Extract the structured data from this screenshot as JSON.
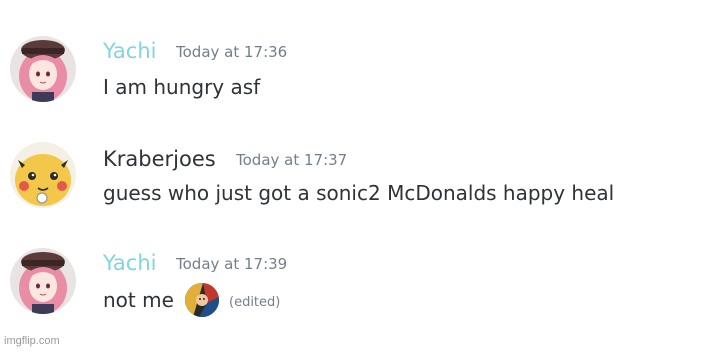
{
  "colors": {
    "yachi_name": "#7ed6df",
    "kraberjoes_name": "#2e3338",
    "timestamp": "#747f8d",
    "message_text": "#2e3338"
  },
  "messages": [
    {
      "author": "Yachi",
      "timestamp": "Today at 17:36",
      "text": "I am hungry asf",
      "avatar_icon": "anime-girl-avatar"
    },
    {
      "author": "Kraberjoes",
      "timestamp": "Today at 17:37",
      "text": "guess who just got a sonic2 McDonalds happy heal",
      "avatar_icon": "pikachu-avatar"
    },
    {
      "author": "Yachi",
      "timestamp": "Today at 17:39",
      "text": "not me",
      "emoji_icon": "custom-emoji-icon",
      "edited_label": "(edited)",
      "avatar_icon": "anime-girl-avatar"
    }
  ],
  "watermark": "imgflip.com"
}
